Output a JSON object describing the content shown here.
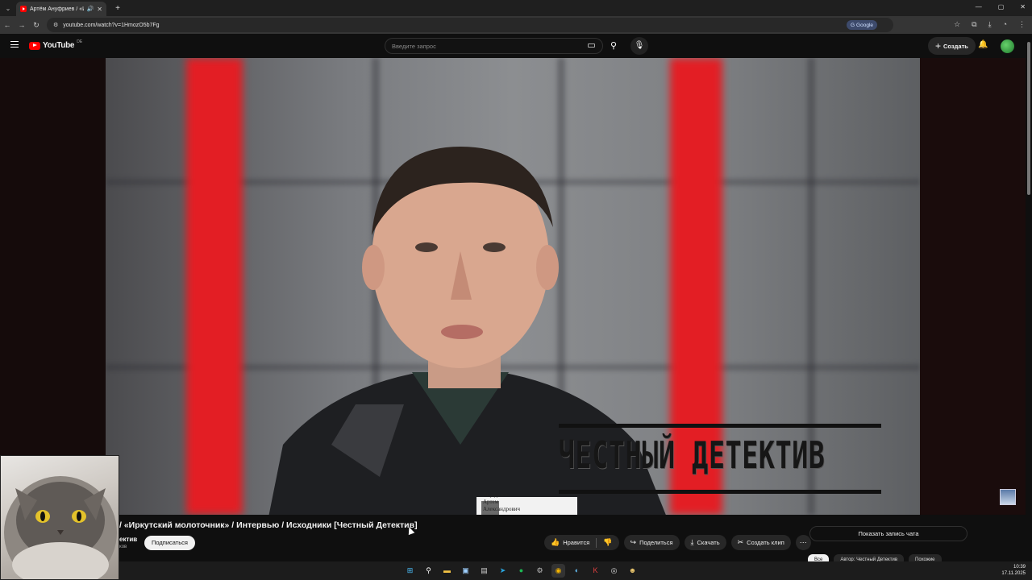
{
  "browser": {
    "tab_title": "Артём Ануфриев / «Ирку",
    "url": "youtube.com/watch?v=1HmozO5b7Fg",
    "google_label": "Google",
    "window_controls": [
      "—",
      "▢",
      "✕"
    ]
  },
  "youtube": {
    "logo_text": "YouTube",
    "region": "DE",
    "search_placeholder": "Введите запрос",
    "create_label": "Создать"
  },
  "video": {
    "watermark": "ЧЕСТНЫЙ ДЕТЕКТИВ",
    "badge_lines": [
      "Ануфриев",
      "Артем",
      "Александрович"
    ],
    "title": "/ «Иркутский молоточник» / Интервью / Исходники [Честный Детектив]",
    "channel_name": "ектив",
    "channel_sub": "ков",
    "subscribe_label": "Подписаться"
  },
  "actions": {
    "like_label": "Нравится",
    "share_label": "Поделиться",
    "download_label": "Скачать",
    "clip_label": "Создать клип"
  },
  "chat": {
    "show_replay_label": "Показать запись чата"
  },
  "chips": [
    "Все",
    "Автор: Честный Детектив",
    "Похожие"
  ],
  "taskbar": {
    "time": "10:39",
    "date": "17.11.2025"
  },
  "colors": {
    "accent": "#ff0000",
    "background": "#0f0f0f",
    "pill": "#272727"
  }
}
